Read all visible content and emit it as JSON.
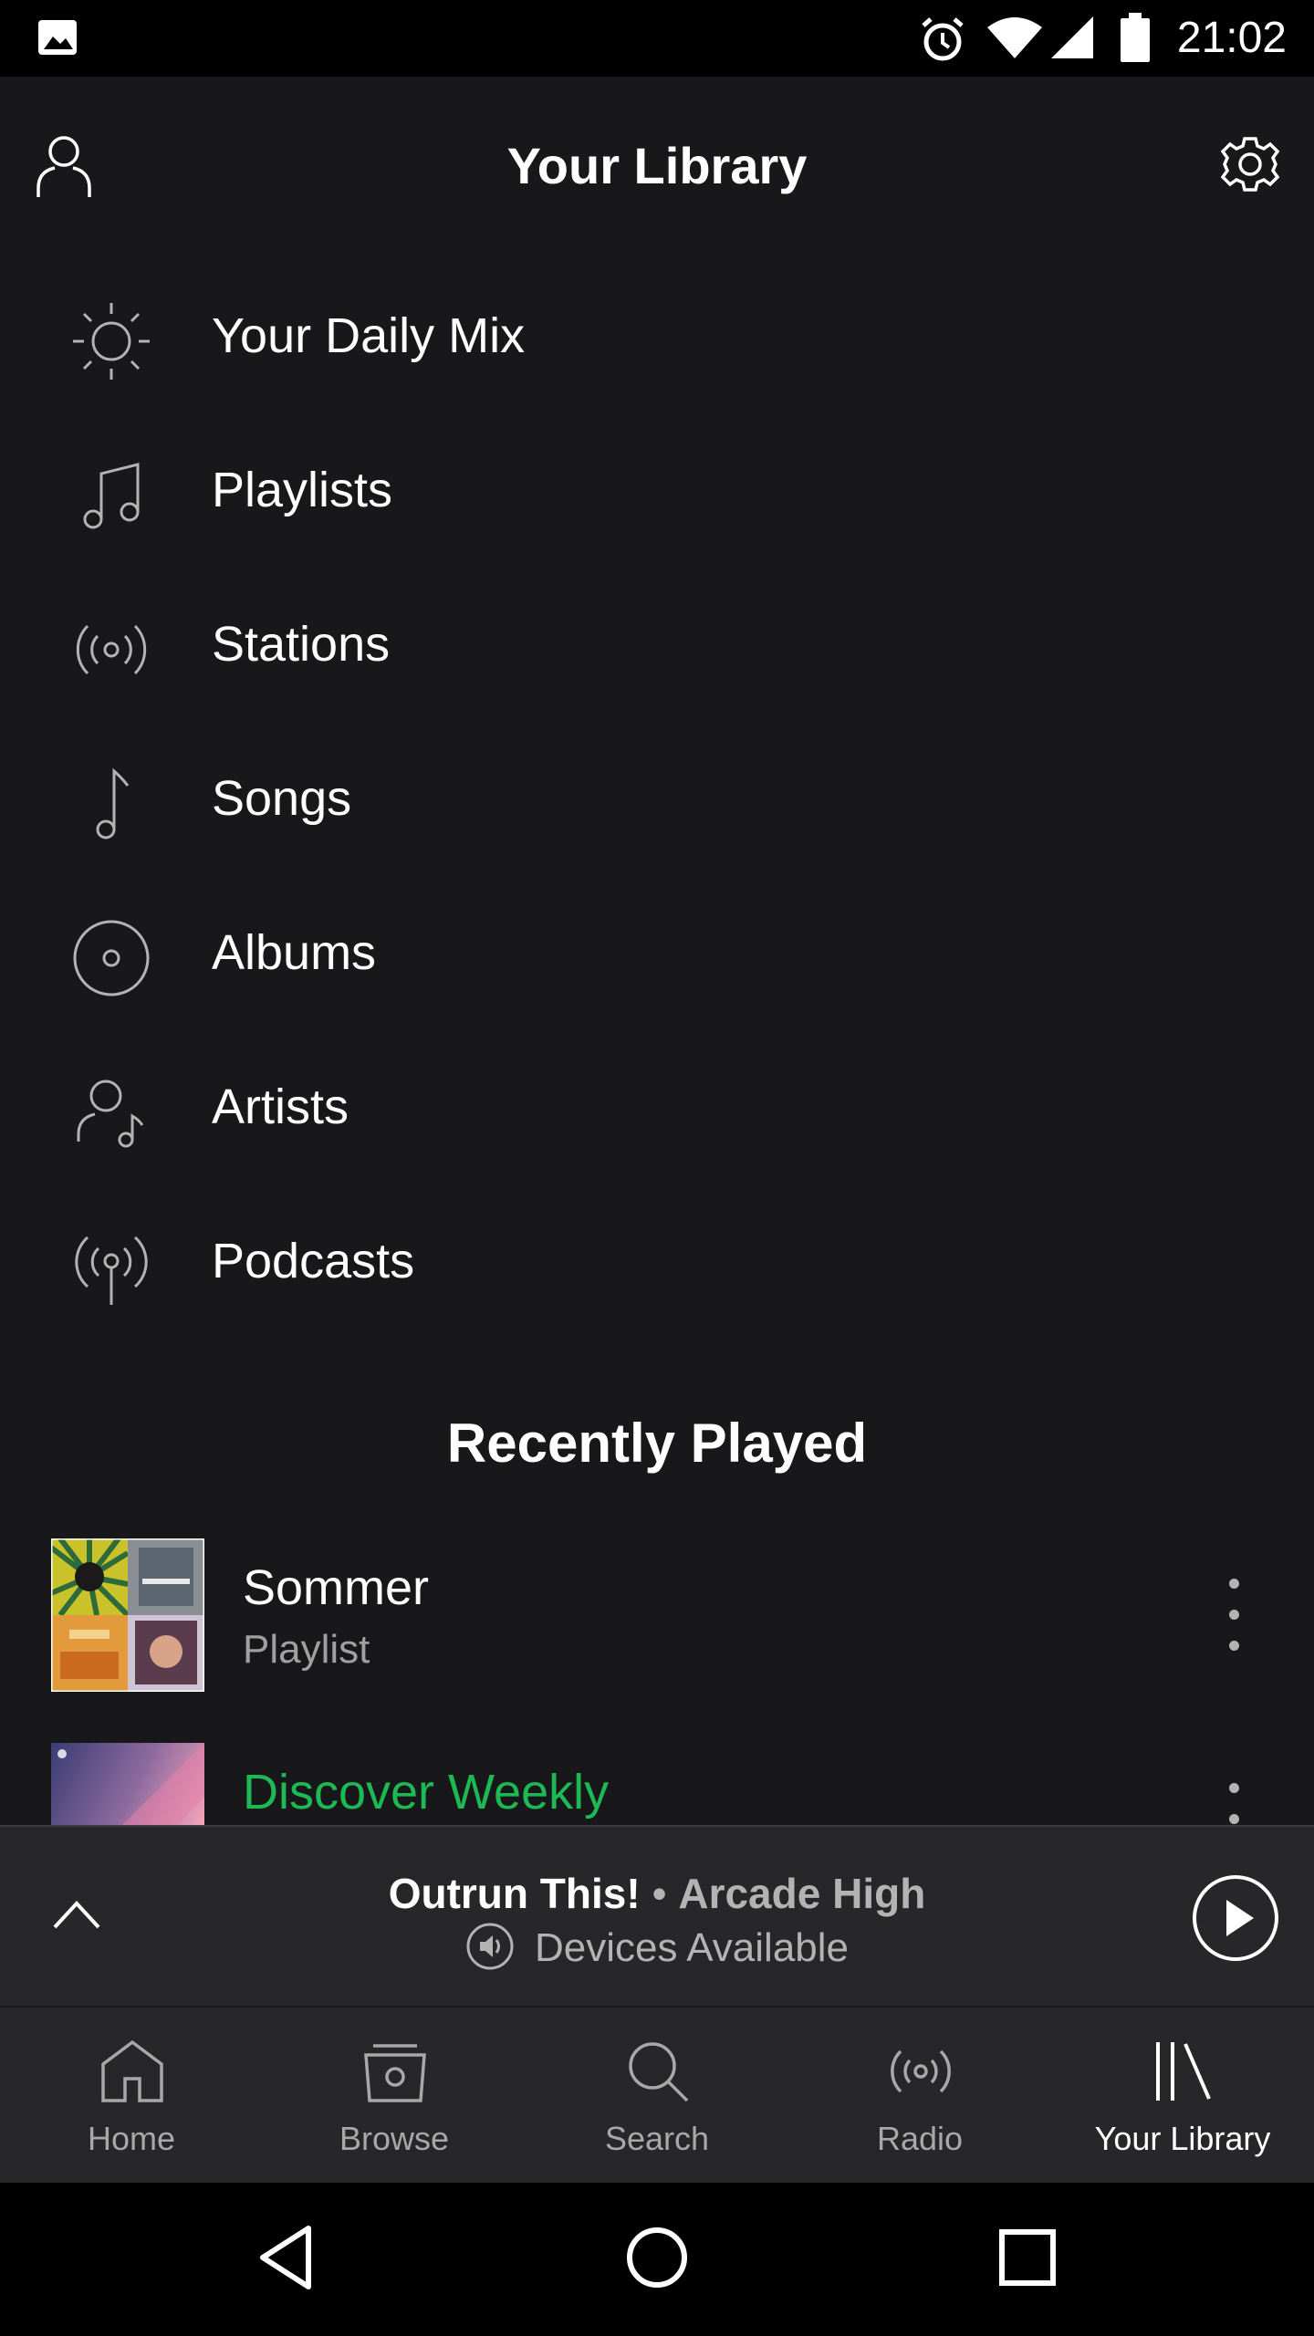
{
  "status_bar": {
    "time": "21:02",
    "icons": [
      "gallery-icon",
      "alarm-icon",
      "wifi-icon",
      "signal-icon",
      "battery-icon"
    ]
  },
  "header": {
    "title": "Your Library",
    "left_icon": "profile-icon",
    "right_icon": "gear-icon"
  },
  "library_items": [
    {
      "label": "Your Daily Mix",
      "icon": "sun-icon"
    },
    {
      "label": "Playlists",
      "icon": "music-notes-icon"
    },
    {
      "label": "Stations",
      "icon": "radio-icon"
    },
    {
      "label": "Songs",
      "icon": "music-note-icon"
    },
    {
      "label": "Albums",
      "icon": "album-icon"
    },
    {
      "label": "Artists",
      "icon": "artist-icon"
    },
    {
      "label": "Podcasts",
      "icon": "podcast-icon"
    }
  ],
  "recently_played": {
    "title": "Recently Played",
    "items": [
      {
        "title": "Sommer",
        "subtitle": "Playlist",
        "title_color": "#ffffff"
      },
      {
        "title": "Discover Weekly",
        "subtitle": "",
        "title_color": "#1db954"
      }
    ]
  },
  "now_playing": {
    "track": "Outrun This!",
    "separator": " • ",
    "artist": "Arcade High",
    "devices": "Devices Available"
  },
  "tabs": [
    {
      "label": "Home",
      "icon": "home-icon",
      "active": false
    },
    {
      "label": "Browse",
      "icon": "browse-icon",
      "active": false
    },
    {
      "label": "Search",
      "icon": "search-icon",
      "active": false
    },
    {
      "label": "Radio",
      "icon": "radio-icon",
      "active": false
    },
    {
      "label": "Your Library",
      "icon": "library-icon",
      "active": true
    }
  ],
  "colors": {
    "background": "#121212",
    "accent_green": "#1db954",
    "secondary_text": "#a0a0a0"
  }
}
